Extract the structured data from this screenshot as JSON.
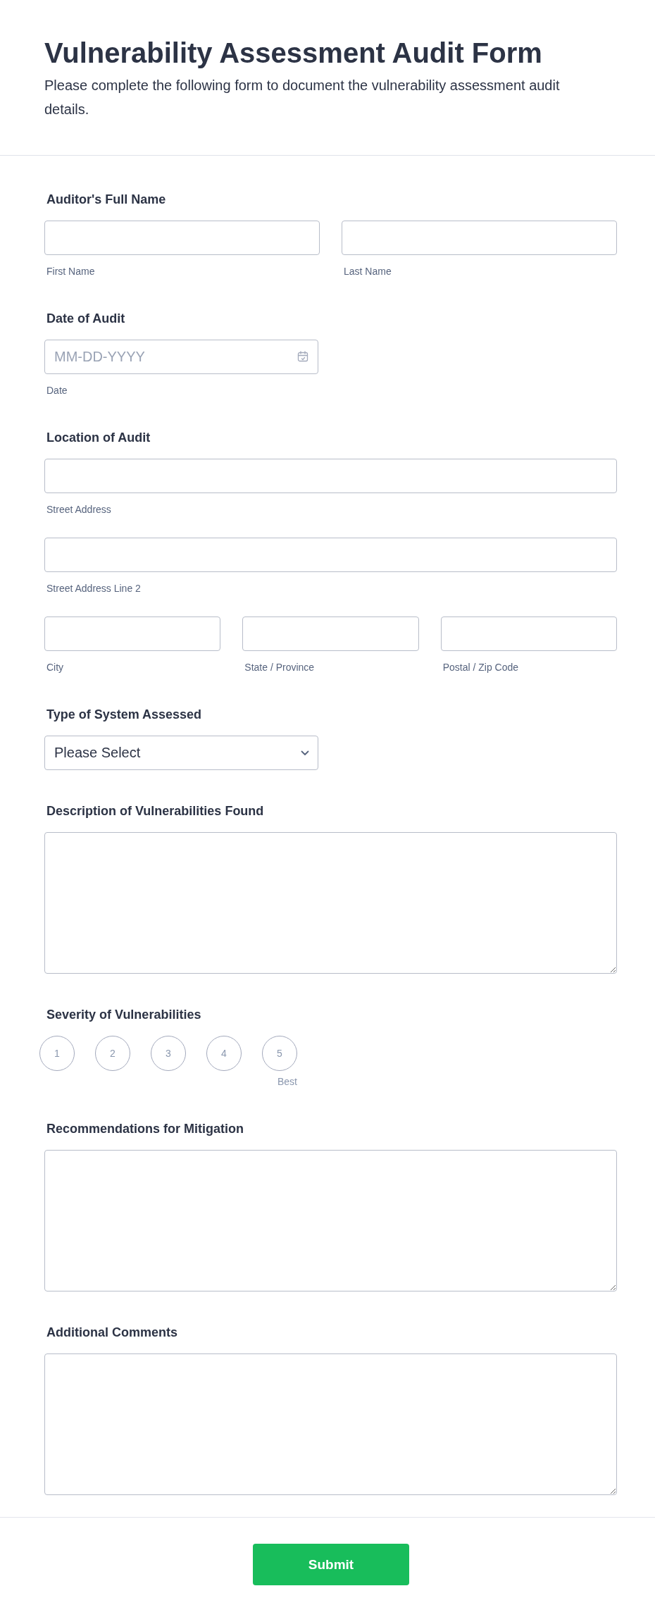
{
  "header": {
    "title": "Vulnerability Assessment Audit Form",
    "description": "Please complete the following form to document the vulnerability assessment audit details."
  },
  "fields": [
    {
      "kind": "name",
      "label": "Auditor's Full Name",
      "inputs": [
        {
          "sublabel": "First Name"
        },
        {
          "sublabel": "Last Name"
        }
      ]
    },
    {
      "kind": "date",
      "label": "Date of Audit",
      "placeholder": "MM-DD-YYYY",
      "sublabel": "Date"
    },
    {
      "kind": "address",
      "label": "Location of Audit",
      "lines": [
        {
          "sublabel": "Street Address"
        },
        {
          "sublabel": "Street Address Line 2"
        }
      ],
      "row": [
        {
          "sublabel": "City"
        },
        {
          "sublabel": "State / Province"
        },
        {
          "sublabel": "Postal / Zip Code"
        }
      ]
    },
    {
      "kind": "dropdown",
      "label": "Type of System Assessed",
      "placeholder": "Please Select"
    },
    {
      "kind": "textarea",
      "label": "Description of Vulnerabilities Found"
    },
    {
      "kind": "scale",
      "label": "Severity of Vulnerabilities",
      "options": [
        {
          "label": "1",
          "selected": false
        },
        {
          "label": "2",
          "selected": false
        },
        {
          "label": "3",
          "selected": false
        },
        {
          "label": "4",
          "selected": false
        },
        {
          "label": "5",
          "selected": false
        }
      ],
      "max_label": "Best"
    },
    {
      "kind": "textarea",
      "label": "Recommendations for Mitigation"
    },
    {
      "kind": "textarea",
      "label": "Additional Comments"
    }
  ],
  "submit": {
    "label": "Submit"
  }
}
